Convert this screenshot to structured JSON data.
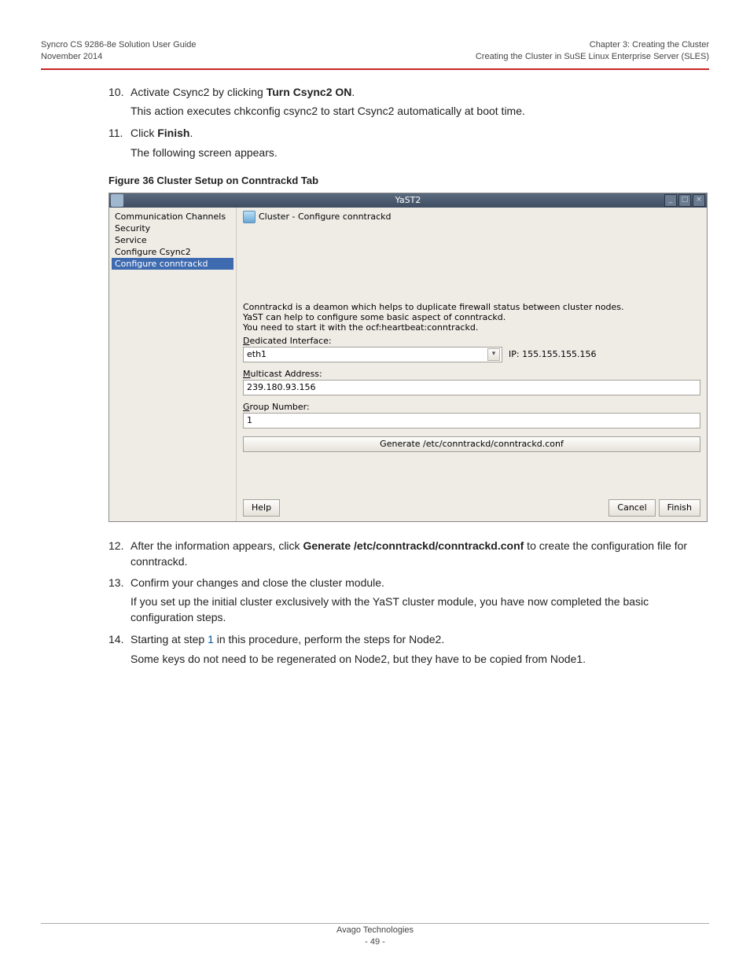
{
  "header": {
    "left_line1": "Syncro CS 9286-8e Solution User Guide",
    "left_line2": "November 2014",
    "right_line1": "Chapter 3: Creating the Cluster",
    "right_line2": "Creating the Cluster in SuSE Linux Enterprise Server (SLES)"
  },
  "steps": {
    "s10_num": "10.",
    "s10_a": "Activate Csync2 by clicking ",
    "s10_b": "Turn Csync2 ON",
    "s10_c": ".",
    "s10_p": "This action executes chkconfig csync2 to start Csync2 automatically at boot time.",
    "s11_num": "11.",
    "s11_a": "Click ",
    "s11_b": "Finish",
    "s11_c": ".",
    "s11_p": "The following screen appears.",
    "s12_num": "12.",
    "s12_a": "After the information appears, click ",
    "s12_b": "Generate /etc/conntrackd/conntrackd.conf",
    "s12_c": " to create the configuration file for conntrackd.",
    "s13_num": "13.",
    "s13_a": "Confirm your changes and close the cluster module.",
    "s13_p": "If you set up the initial cluster exclusively with the YaST cluster module, you have now completed the basic configuration steps.",
    "s14_num": "14.",
    "s14_a": "Starting at step ",
    "s14_link": "1",
    "s14_b": " in this procedure, perform the steps for Node2.",
    "s14_p": "Some keys do not need to be regenerated on Node2, but they have to be copied from Node1."
  },
  "figure_caption": "Figure 36  Cluster Setup on Conntrackd Tab",
  "yast": {
    "title": "YaST2",
    "side": {
      "i0": "Communication Channels",
      "i1": "Security",
      "i2": "Service",
      "i3": "Configure Csync2",
      "i4": "Configure conntrackd"
    },
    "panel_title": "Cluster - Configure conntrackd",
    "desc1": "Conntrackd is a deamon which helps to duplicate firewall status between cluster nodes.",
    "desc2": "YaST can help to configure some basic aspect of conntrackd.",
    "desc3": "You need to start it with the ocf:heartbeat:conntrackd.",
    "lbl_iface_pre": "D",
    "lbl_iface_rest": "edicated Interface:",
    "iface_value": "eth1",
    "ip_label": "IP: 155.155.155.156",
    "lbl_mcast_pre": "M",
    "lbl_mcast_rest": "ulticast Address:",
    "mcast_value": "239.180.93.156",
    "lbl_group_pre": "G",
    "lbl_group_rest": "roup Number:",
    "group_value": "1",
    "generate_pre": "G",
    "generate_rest": "enerate /etc/conntrackd/conntrackd.conf",
    "btn_help": "Help",
    "btn_cancel_pre": "C",
    "btn_cancel_rest": "ancel",
    "btn_finish_pre": "F",
    "btn_finish_rest": "inish"
  },
  "footer": {
    "line1": "Avago Technologies",
    "line2": "- 49 -"
  }
}
